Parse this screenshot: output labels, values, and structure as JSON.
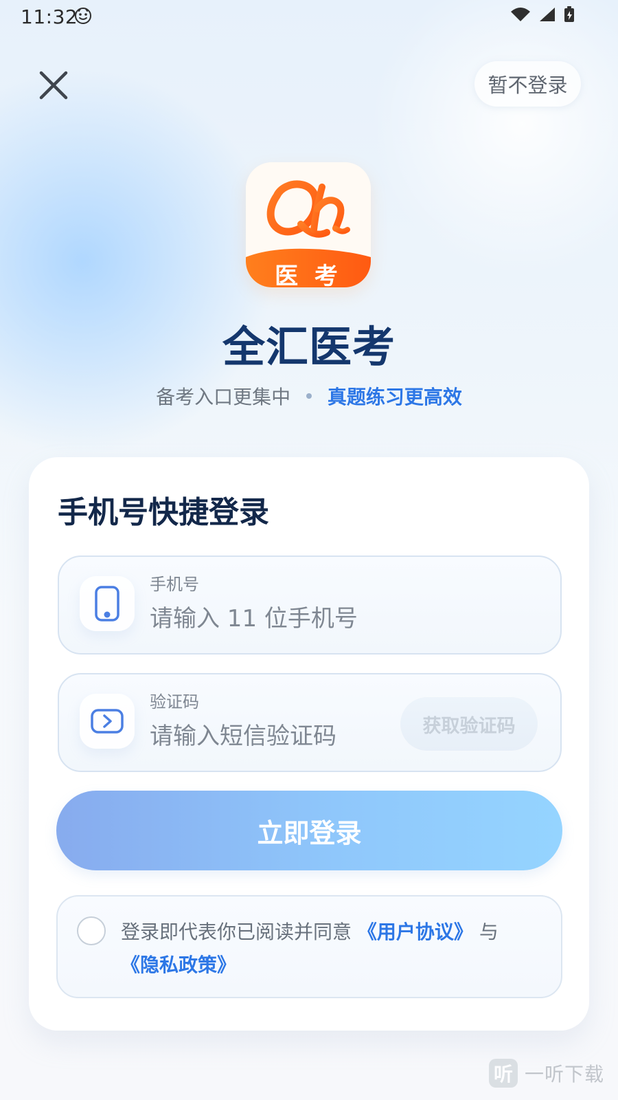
{
  "status_bar": {
    "time": "11:32"
  },
  "header": {
    "close_icon": "close-icon",
    "skip_label": "暂不登录"
  },
  "app": {
    "logo_text": "Qh",
    "logo_badge": "医  考",
    "title": "全汇医考",
    "slogan_left": "备考入口更集中",
    "slogan_right": "真题练习更高效"
  },
  "login": {
    "title": "手机号快捷登录",
    "phone": {
      "label": "手机号",
      "placeholder": "请输入 11 位手机号",
      "icon": "phone-icon"
    },
    "code": {
      "label": "验证码",
      "placeholder": "请输入短信验证码",
      "icon": "message-code-icon",
      "button": "获取验证码"
    },
    "submit": "立即登录",
    "agreement": {
      "prefix": "登录即代表你已阅读并同意",
      "user_agreement": "《用户协议》",
      "joiner": "与",
      "privacy_policy": "《隐私政策》"
    }
  },
  "watermark": {
    "badge": "听",
    "text": "一听下载"
  },
  "colors": {
    "title_blue": "#14376d",
    "link_blue": "#2d77e6",
    "brand_orange": "#ff6a1a"
  }
}
